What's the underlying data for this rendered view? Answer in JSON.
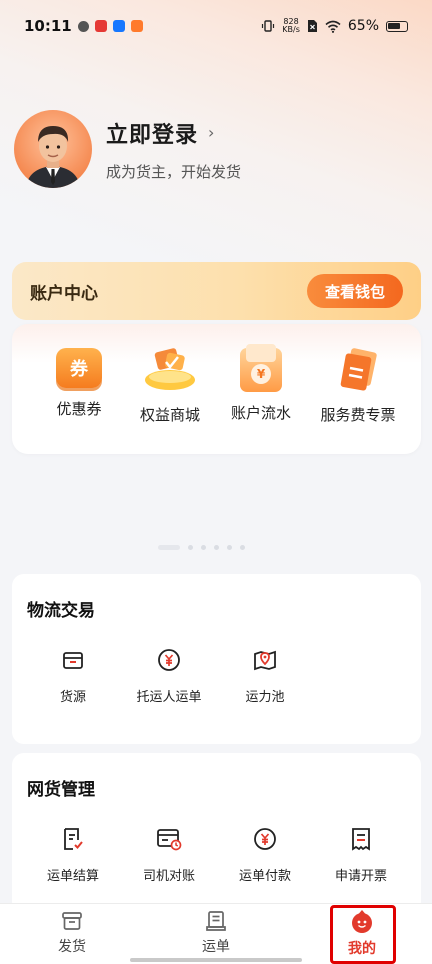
{
  "status_bar": {
    "time": "10:11",
    "network_speed_value": "828",
    "network_speed_unit": "KB/s",
    "battery": "65%"
  },
  "profile": {
    "title": "立即登录",
    "arrow": "›",
    "subtitle": "成为货主，开始发货"
  },
  "account": {
    "title": "账户中心",
    "wallet_button": "查看钱包",
    "items": [
      {
        "label": "优惠券",
        "icon": "coupon-icon",
        "icon_text": "券"
      },
      {
        "label": "权益商城",
        "icon": "benefits-mall-icon"
      },
      {
        "label": "账户流水",
        "icon": "account-statement-icon",
        "icon_text": "¥"
      },
      {
        "label": "服务费专票",
        "icon": "service-invoice-icon"
      }
    ]
  },
  "logistics": {
    "title": "物流交易",
    "items": [
      {
        "label": "货源",
        "icon": "cargo-box-icon"
      },
      {
        "label": "托运人运单",
        "icon": "shipper-waybill-icon"
      },
      {
        "label": "运力池",
        "icon": "capacity-pool-icon"
      }
    ]
  },
  "freight": {
    "title": "网货管理",
    "items": [
      {
        "label": "运单结算",
        "icon": "waybill-settlement-icon"
      },
      {
        "label": "司机对账",
        "icon": "driver-reconcile-icon"
      },
      {
        "label": "运单付款",
        "icon": "waybill-payment-icon"
      },
      {
        "label": "申请开票",
        "icon": "apply-invoice-icon"
      }
    ]
  },
  "tabs": [
    {
      "label": "发货",
      "icon": "ship-icon"
    },
    {
      "label": "运单",
      "icon": "waybill-icon"
    },
    {
      "label": "我的",
      "icon": "mine-icon",
      "active": true
    }
  ],
  "colors": {
    "accent": "#f4681f",
    "active_tab": "#e23a2c",
    "highlight_box": "#e00000"
  }
}
